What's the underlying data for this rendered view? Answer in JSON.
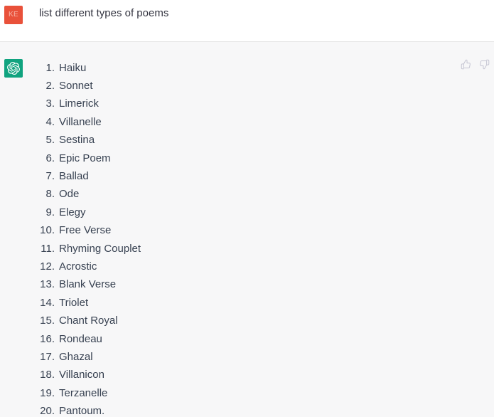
{
  "conversation": {
    "messages": [
      {
        "role": "user",
        "avatar_initials": "KE",
        "avatar_color": "#e9513a",
        "avatar_icon": "user-initials-avatar",
        "text": "list different types of poems"
      },
      {
        "role": "assistant",
        "avatar_color": "#10a37f",
        "avatar_icon": "openai-logo-icon",
        "list_items": [
          "Haiku",
          "Sonnet",
          "Limerick",
          "Villanelle",
          "Sestina",
          "Epic Poem",
          "Ballad",
          "Ode",
          "Elegy",
          "Free Verse",
          "Rhyming Couplet",
          "Acrostic",
          "Blank Verse",
          "Triolet",
          "Chant Royal",
          "Rondeau",
          "Ghazal",
          "Villanicon",
          "Terzanelle",
          "Pantoum."
        ],
        "actions": {
          "thumbs_up_icon": "thumbs-up-icon",
          "thumbs_down_icon": "thumbs-down-icon",
          "icon_color": "#c5c5d2"
        }
      }
    ]
  },
  "theme": {
    "user_bg": "#ffffff",
    "assistant_bg": "#f7f7f8",
    "divider": "#e5e5e5",
    "text_color": "#374151"
  }
}
